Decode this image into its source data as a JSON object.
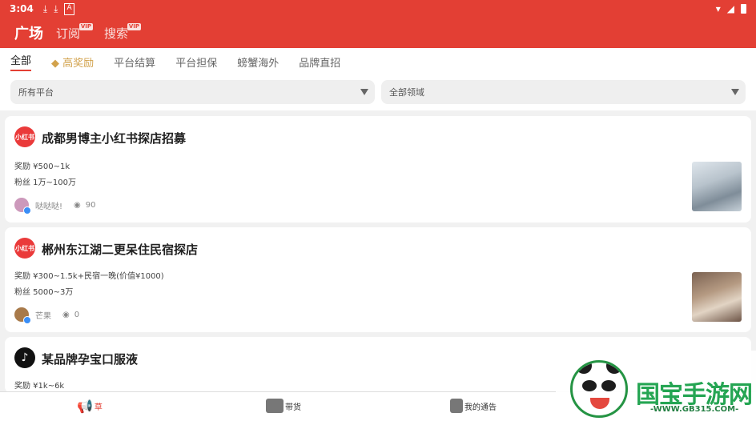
{
  "status": {
    "time": "3:04",
    "left_icons": [
      "download-icon",
      "download-icon",
      "a-icon"
    ],
    "right_icons": [
      "wifi-icon",
      "signal-icon",
      "battery-icon"
    ]
  },
  "appbar": {
    "nav": [
      {
        "label": "广场",
        "active": true,
        "vip": false
      },
      {
        "label": "订阅",
        "active": false,
        "vip": true
      },
      {
        "label": "搜索",
        "active": false,
        "vip": true
      }
    ],
    "vip_label": "VIP",
    "bg_color": "#e33f34"
  },
  "tabs": [
    "全部",
    "高奖励",
    "平台结算",
    "平台担保",
    "螃蟹海外",
    "品牌直招"
  ],
  "filters": {
    "platform": "所有平台",
    "domain": "全部领域"
  },
  "cards": [
    {
      "platform_logo": "小红书",
      "title": "成都男博主小红书探店招募",
      "reward": "奖励 ¥500~1k",
      "fans": "粉丝 1万~100万",
      "user": "哒哒哒!",
      "views": "90"
    },
    {
      "platform_logo": "小红书",
      "title": "郴州东江湖二更呆住民宿探店",
      "reward": "奖励 ¥300~1.5k+民宿一晚(价值¥1000)",
      "fans": "粉丝 5000~3万",
      "user": "芒果",
      "views": "0"
    },
    {
      "platform_logo": "♪",
      "title": "某品牌孕宝口服液",
      "reward": "奖励 ¥1k~6k"
    }
  ],
  "bottom_nav": [
    {
      "label": "草",
      "active": true
    },
    {
      "label": "带货",
      "active": false
    },
    {
      "label": "我的通告",
      "active": false
    }
  ],
  "watermark": {
    "brand": "国宝手游网",
    "url": "-WWW.GB315.COM-"
  }
}
